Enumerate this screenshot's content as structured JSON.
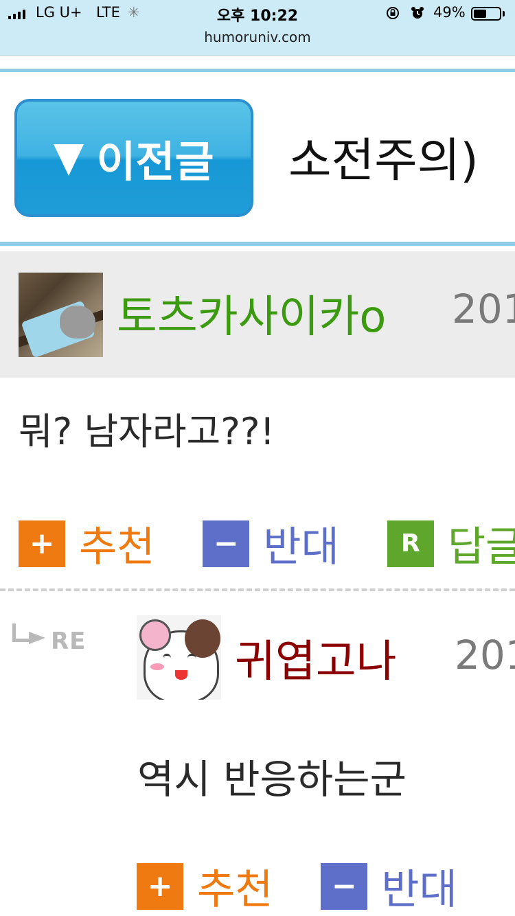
{
  "status_bar": {
    "carrier": "LG U+",
    "network": "LTE",
    "time": "오후 10:22",
    "url": "humoruniv.com",
    "battery_percent": "49%",
    "battery_level": 0.49
  },
  "nav": {
    "prev_label": "이전글",
    "prev_title": "소전주의)"
  },
  "post": {
    "author": "토츠카사이카o",
    "date": "201",
    "comment": "뭐? 남자라고??!",
    "actions": {
      "recommend_icon": "+",
      "recommend": "추천",
      "oppose_icon": "−",
      "oppose": "반대",
      "reply_icon": "R",
      "reply": "답글"
    }
  },
  "reply": {
    "marker": "RE",
    "author": "귀엽고나",
    "date": "201",
    "comment": "역시 반응하는군",
    "actions": {
      "recommend_icon": "+",
      "recommend": "추천",
      "oppose_icon": "−",
      "oppose": "반대"
    }
  },
  "colors": {
    "accent_blue": "#1f9dd8",
    "author_green": "#3c9a10",
    "author_red": "#8b0000",
    "recommend_orange": "#ef7a12",
    "oppose_blue": "#5d6fc9",
    "reply_green": "#5fa72c"
  }
}
